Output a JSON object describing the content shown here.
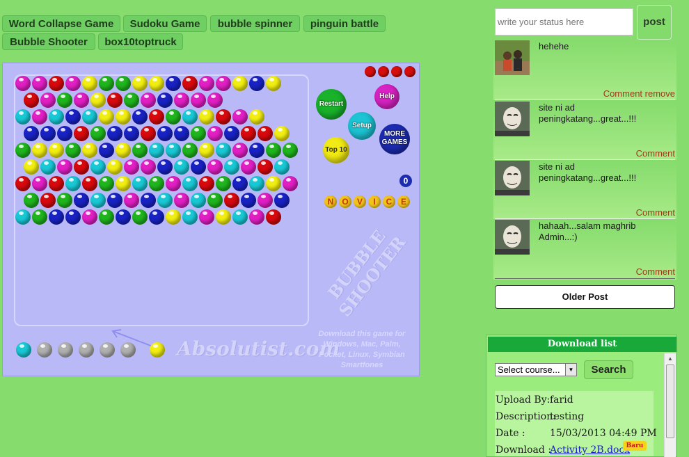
{
  "tabs": [
    "Word Collapse Game",
    "Sudoku Game",
    "bubble spinner",
    "pinguin battle",
    "Bubble Shooter",
    "box10toptruck"
  ],
  "game": {
    "buttons": {
      "restart": "Restart",
      "help": "Help",
      "setup": "Setup",
      "more_games": "MORE GAMES",
      "top10": "Top 10"
    },
    "score": "0",
    "level_letters": [
      "N",
      "O",
      "V",
      "I",
      "C",
      "E"
    ],
    "logo_title": "BUBBLE SHOOTER",
    "brand": "Absolutist.com",
    "download_note": "Download this game for Windows, Mac, Palm, Pocket, Linux, Symbian Smartfones",
    "ball_colors": {
      "m": "#e21fc5",
      "r": "#d8090d",
      "y": "#f2ee12",
      "g": "#1fb51d",
      "c": "#18c9d5",
      "b": "#1822c5",
      "w": "#b0b0b0"
    },
    "rows": [
      "mmrmyggyybrmmyby",
      "rmgmyrgmbmmm",
      "cmcbcyybrgcyrmy",
      "bbbrgbbrbbgmbrry",
      "gyygybygccgycmbgg",
      "ycmrcymmbcbmcmrc",
      "rmrcrgycgmcrgbcym",
      "grgbcbmbcmcgrbmb",
      "cgbbmgbgbycmycmr"
    ],
    "queue": [
      "c",
      "w",
      "w",
      "w",
      "w",
      "w",
      "y"
    ]
  },
  "status": {
    "placeholder": "write your status here",
    "post_label": "post"
  },
  "feed": [
    {
      "text": "hehehe",
      "action": "Comment remove"
    },
    {
      "text": "site ni ad peningkatang...great...!!!",
      "action": "Comment"
    },
    {
      "text": "site ni ad peningkatang...great...!!!",
      "action": "Comment"
    },
    {
      "text": "hahaah...salam maghrib Admin...:)",
      "action": "Comment"
    }
  ],
  "older_post": "Older Post",
  "download": {
    "header": "Download list",
    "select_value": "Select course...",
    "search_label": "Search",
    "rows": [
      {
        "k": "Upload By:",
        "v": "farid"
      },
      {
        "k": "Description:",
        "v": "testing"
      },
      {
        "k": "Date :",
        "v": "15/03/2013 04:49 PM"
      },
      {
        "k": "Download :",
        "v": "Activity 2B.docx"
      }
    ],
    "badge": "Baru"
  }
}
